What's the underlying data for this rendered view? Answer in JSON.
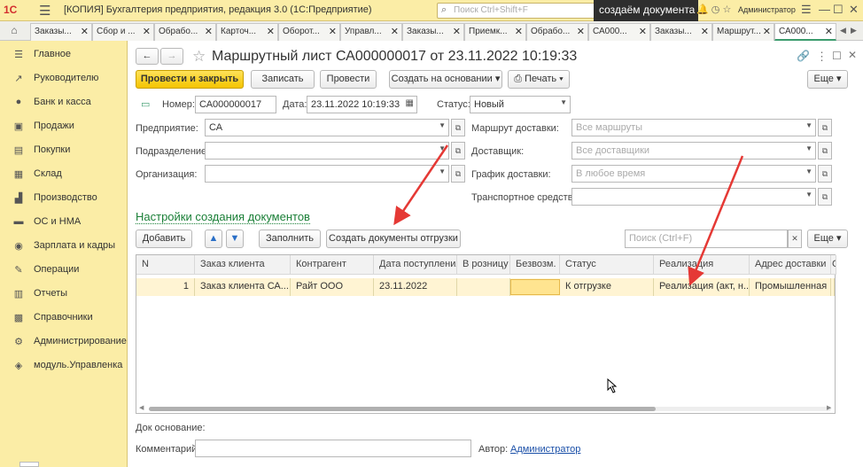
{
  "titlebar": {
    "logo": "1С",
    "title": "[КОПИЯ] Бухгалтерия предприятия, редакция 3.0  (1С:Предприятие)",
    "search_placeholder": "Поиск Ctrl+Shift+F",
    "caption": "создаём документа",
    "user": "Администратор"
  },
  "tabs": [
    {
      "label": "Заказы..."
    },
    {
      "label": "Сбор и ..."
    },
    {
      "label": "Обрабо..."
    },
    {
      "label": "Карточ..."
    },
    {
      "label": "Оборот..."
    },
    {
      "label": "Управл..."
    },
    {
      "label": "Заказы..."
    },
    {
      "label": "Приемк..."
    },
    {
      "label": "Обрабо..."
    },
    {
      "label": "СА000..."
    },
    {
      "label": "Заказы..."
    },
    {
      "label": "Маршрут..."
    },
    {
      "label": "СА000..."
    }
  ],
  "sidebar": {
    "items": [
      {
        "label": "Главное",
        "icon": "menu-icon"
      },
      {
        "label": "Руководителю",
        "icon": "chart-icon"
      },
      {
        "label": "Банк и касса",
        "icon": "bank-icon"
      },
      {
        "label": "Продажи",
        "icon": "sales-icon"
      },
      {
        "label": "Покупки",
        "icon": "cart-icon"
      },
      {
        "label": "Склад",
        "icon": "warehouse-icon"
      },
      {
        "label": "Производство",
        "icon": "factory-icon"
      },
      {
        "label": "ОС и НМА",
        "icon": "assets-icon"
      },
      {
        "label": "Зарплата и кадры",
        "icon": "people-icon"
      },
      {
        "label": "Операции",
        "icon": "operations-icon"
      },
      {
        "label": "Отчеты",
        "icon": "reports-icon"
      },
      {
        "label": "Справочники",
        "icon": "books-icon"
      },
      {
        "label": "Администрирование",
        "icon": "gear-icon"
      },
      {
        "label": "модуль.Управленка",
        "icon": "module-icon"
      }
    ]
  },
  "form": {
    "title": "Маршрутный лист СА000000017 от 23.11.2022 10:19:33",
    "toolbar": {
      "post_close": "Провести и закрыть",
      "save": "Записать",
      "post": "Провести",
      "create_based": "Создать на основании",
      "print": "Печать",
      "more": "Еще"
    },
    "number_label": "Номер:",
    "number_value": "СА000000017",
    "date_label": "Дата:",
    "date_value": "23.11.2022 10:19:33",
    "status_label": "Статус:",
    "status_value": "Новый",
    "enterprise_label": "Предприятие:",
    "enterprise_value": "СА",
    "division_label": "Подразделение:",
    "division_value": "",
    "org_label": "Организация:",
    "org_value": "",
    "route_label": "Маршрут доставки:",
    "route_placeholder": "Все маршруты",
    "supplier_label": "Доставщик:",
    "supplier_placeholder": "Все доставщики",
    "schedule_label": "График доставки:",
    "schedule_placeholder": "В любое время",
    "vehicle_label": "Транспортное средство:",
    "vehicle_value": "",
    "settings_link": "Настройки создания документов",
    "add_button": "Добавить",
    "fill_button": "Заполнить",
    "create_shipment_button": "Создать документы отгрузки",
    "search_placeholder": "Поиск (Ctrl+F)",
    "more2": "Еще",
    "grid": {
      "columns": [
        "N",
        "Заказ клиента",
        "Контрагент",
        "Дата поступления",
        "В розницу",
        "Безвозм.",
        "Статус",
        "Реализация",
        "Адрес доставки",
        "С"
      ],
      "rows": [
        [
          "1",
          "Заказ клиента СА...",
          "Райт ООО",
          "23.11.2022",
          "",
          "",
          "К отгрузке",
          "Реализация (акт, н...",
          "Промышленная",
          ""
        ]
      ]
    },
    "basis_label": "Док основание:",
    "comment_label": "Комментарий:",
    "comment_value": "",
    "author_label": "Автор:",
    "author_value": "Администратор"
  },
  "colors": {
    "sidebar_bg": "#fbeda6",
    "primary_button": "#f4c400",
    "link": "#1a7f37",
    "row_highlight": "#fff4d3",
    "annotation_arrow": "#e53935"
  }
}
